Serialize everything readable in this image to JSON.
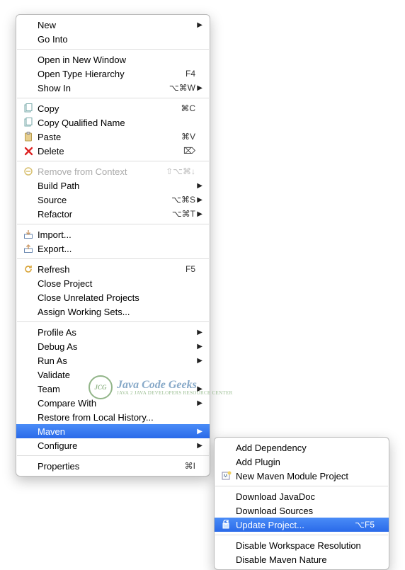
{
  "main_menu": {
    "groups": [
      [
        {
          "label": "New",
          "shortcut": "",
          "arrow": true,
          "icon": "",
          "disabled": false,
          "selected": false
        },
        {
          "label": "Go Into",
          "shortcut": "",
          "arrow": false,
          "icon": "",
          "disabled": false,
          "selected": false
        }
      ],
      [
        {
          "label": "Open in New Window",
          "shortcut": "",
          "arrow": false,
          "icon": "",
          "disabled": false,
          "selected": false
        },
        {
          "label": "Open Type Hierarchy",
          "shortcut": "F4",
          "arrow": false,
          "icon": "",
          "disabled": false,
          "selected": false
        },
        {
          "label": "Show In",
          "shortcut": "⌥⌘W",
          "arrow": true,
          "icon": "",
          "disabled": false,
          "selected": false
        }
      ],
      [
        {
          "label": "Copy",
          "shortcut": "⌘C",
          "arrow": false,
          "icon": "copy",
          "disabled": false,
          "selected": false
        },
        {
          "label": "Copy Qualified Name",
          "shortcut": "",
          "arrow": false,
          "icon": "copy",
          "disabled": false,
          "selected": false
        },
        {
          "label": "Paste",
          "shortcut": "⌘V",
          "arrow": false,
          "icon": "paste",
          "disabled": false,
          "selected": false
        },
        {
          "label": "Delete",
          "shortcut": "⌦",
          "arrow": false,
          "icon": "delete",
          "disabled": false,
          "selected": false
        }
      ],
      [
        {
          "label": "Remove from Context",
          "shortcut": "⇧⌥⌘↓",
          "arrow": false,
          "icon": "remove-context",
          "disabled": true,
          "selected": false
        },
        {
          "label": "Build Path",
          "shortcut": "",
          "arrow": true,
          "icon": "",
          "disabled": false,
          "selected": false
        },
        {
          "label": "Source",
          "shortcut": "⌥⌘S",
          "arrow": true,
          "icon": "",
          "disabled": false,
          "selected": false
        },
        {
          "label": "Refactor",
          "shortcut": "⌥⌘T",
          "arrow": true,
          "icon": "",
          "disabled": false,
          "selected": false
        }
      ],
      [
        {
          "label": "Import...",
          "shortcut": "",
          "arrow": false,
          "icon": "import",
          "disabled": false,
          "selected": false
        },
        {
          "label": "Export...",
          "shortcut": "",
          "arrow": false,
          "icon": "export",
          "disabled": false,
          "selected": false
        }
      ],
      [
        {
          "label": "Refresh",
          "shortcut": "F5",
          "arrow": false,
          "icon": "refresh",
          "disabled": false,
          "selected": false
        },
        {
          "label": "Close Project",
          "shortcut": "",
          "arrow": false,
          "icon": "",
          "disabled": false,
          "selected": false
        },
        {
          "label": "Close Unrelated Projects",
          "shortcut": "",
          "arrow": false,
          "icon": "",
          "disabled": false,
          "selected": false
        },
        {
          "label": "Assign Working Sets...",
          "shortcut": "",
          "arrow": false,
          "icon": "",
          "disabled": false,
          "selected": false
        }
      ],
      [
        {
          "label": "Profile As",
          "shortcut": "",
          "arrow": true,
          "icon": "",
          "disabled": false,
          "selected": false
        },
        {
          "label": "Debug As",
          "shortcut": "",
          "arrow": true,
          "icon": "",
          "disabled": false,
          "selected": false
        },
        {
          "label": "Run As",
          "shortcut": "",
          "arrow": true,
          "icon": "",
          "disabled": false,
          "selected": false
        },
        {
          "label": "Validate",
          "shortcut": "",
          "arrow": false,
          "icon": "",
          "disabled": false,
          "selected": false
        },
        {
          "label": "Team",
          "shortcut": "",
          "arrow": true,
          "icon": "",
          "disabled": false,
          "selected": false
        },
        {
          "label": "Compare With",
          "shortcut": "",
          "arrow": true,
          "icon": "",
          "disabled": false,
          "selected": false
        },
        {
          "label": "Restore from Local History...",
          "shortcut": "",
          "arrow": false,
          "icon": "",
          "disabled": false,
          "selected": false
        },
        {
          "label": "Maven",
          "shortcut": "",
          "arrow": true,
          "icon": "",
          "disabled": false,
          "selected": true
        },
        {
          "label": "Configure",
          "shortcut": "",
          "arrow": true,
          "icon": "",
          "disabled": false,
          "selected": false
        }
      ],
      [
        {
          "label": "Properties",
          "shortcut": "⌘I",
          "arrow": false,
          "icon": "",
          "disabled": false,
          "selected": false
        }
      ]
    ]
  },
  "sub_menu": {
    "groups": [
      [
        {
          "label": "Add Dependency",
          "shortcut": "",
          "arrow": false,
          "icon": "",
          "disabled": false,
          "selected": false
        },
        {
          "label": "Add Plugin",
          "shortcut": "",
          "arrow": false,
          "icon": "",
          "disabled": false,
          "selected": false
        },
        {
          "label": "New Maven Module Project",
          "shortcut": "",
          "arrow": false,
          "icon": "maven-module",
          "disabled": false,
          "selected": false
        }
      ],
      [
        {
          "label": "Download JavaDoc",
          "shortcut": "",
          "arrow": false,
          "icon": "",
          "disabled": false,
          "selected": false
        },
        {
          "label": "Download Sources",
          "shortcut": "",
          "arrow": false,
          "icon": "",
          "disabled": false,
          "selected": false
        },
        {
          "label": "Update Project...",
          "shortcut": "⌥F5",
          "arrow": false,
          "icon": "update",
          "disabled": false,
          "selected": true
        }
      ],
      [
        {
          "label": "Disable Workspace Resolution",
          "shortcut": "",
          "arrow": false,
          "icon": "",
          "disabled": false,
          "selected": false
        },
        {
          "label": "Disable Maven Nature",
          "shortcut": "",
          "arrow": false,
          "icon": "",
          "disabled": false,
          "selected": false
        }
      ]
    ]
  },
  "watermark": {
    "badge": "JCG",
    "title": "Java Code Geeks",
    "subtitle": "JAVA 2 JAVA DEVELOPERS RESOURCE CENTER"
  }
}
